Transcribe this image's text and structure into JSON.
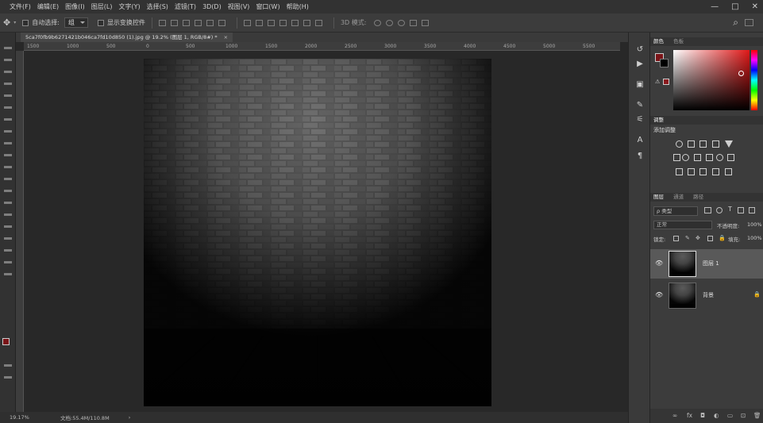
{
  "menu": [
    "文件(F)",
    "编辑(E)",
    "图像(I)",
    "图层(L)",
    "文字(Y)",
    "选择(S)",
    "滤镜(T)",
    "3D(D)",
    "视图(V)",
    "窗口(W)",
    "帮助(H)"
  ],
  "window_controls": {
    "minimize": "—",
    "restore": "□",
    "close": "✕"
  },
  "options_bar": {
    "move_icon": "✥",
    "auto_select_label": "自动选择:",
    "auto_select_value": "组",
    "show_transform_label": "显示变换控件",
    "mode3d_label": "3D 模式:",
    "search_icon": "⌕"
  },
  "document_tab": {
    "title": "5ca7f0fb9b6271421b046ca7fd10d850 (1).jpg @ 19.2% (图层 1, RGB/8#) *",
    "close": "×"
  },
  "ruler_ticks": [
    "1500",
    "1000",
    "500",
    "0",
    "500",
    "1000",
    "1500",
    "2000",
    "2500",
    "3000",
    "3500",
    "4000",
    "4500",
    "5000",
    "5500"
  ],
  "status": {
    "zoom": "19.17%",
    "doc": "文档:55.4M/110.8M",
    "arrow": "›"
  },
  "panels": {
    "color_tabs": [
      "颜色",
      "色板"
    ],
    "adjustments_tabs": [
      "调整"
    ],
    "adjust_add_label": "添加调整",
    "layers_tabs": [
      "图层",
      "通道",
      "路径"
    ],
    "kind_filter": "ρ 类型",
    "blend_mode": "正常",
    "opacity_label": "不透明度:",
    "opacity_value": "100%",
    "lock_label": "锁定:",
    "fill_label": "填充:",
    "fill_value": "100%",
    "layers": [
      {
        "name": "图层 1",
        "visible": "👁",
        "selected": true
      },
      {
        "name": "背景",
        "visible": "👁",
        "locked": "🔒"
      }
    ],
    "bottom_icons": [
      "∞",
      "fx",
      "◘",
      "◐",
      "▭",
      "⊡",
      "🗑"
    ]
  },
  "colors": {
    "foreground": "#7a1418",
    "background": "#000000",
    "accent": "#e01818"
  }
}
